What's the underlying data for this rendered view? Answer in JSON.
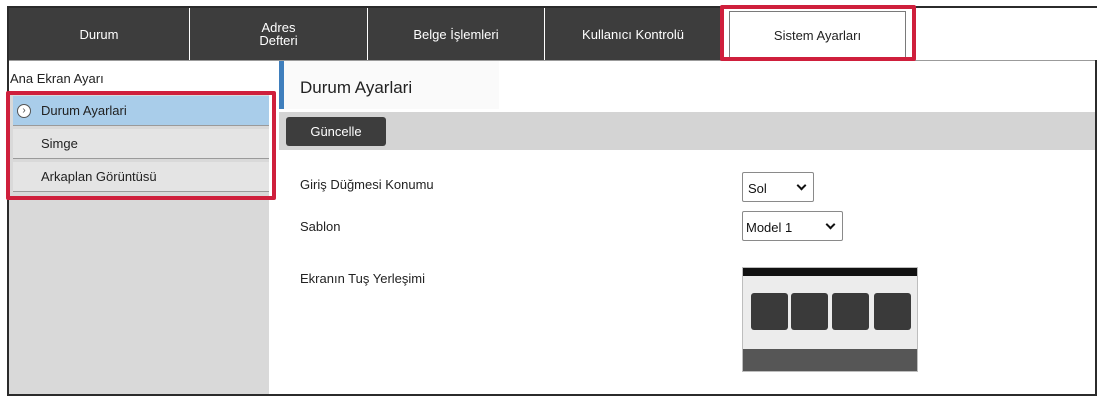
{
  "tabs": [
    {
      "label": "Durum"
    },
    {
      "label_line1": "Adres",
      "label_line2": "Defteri"
    },
    {
      "label": "Belge İşlemleri"
    },
    {
      "label": "Kullanıcı Kontrolü"
    },
    {
      "label": "Sistem Ayarları",
      "active": true
    }
  ],
  "sidebar": {
    "heading": "Ana Ekran Ayarı",
    "items": [
      {
        "label": "Durum Ayarlari",
        "selected": true,
        "icon": "chevron-right-circle-icon"
      },
      {
        "label": "Simge"
      },
      {
        "label": "Arkaplan Görüntüsü"
      }
    ]
  },
  "main": {
    "title": "Durum Ayarlari",
    "update_button": "Güncelle",
    "fields": [
      {
        "label": "Giriş Düğmesi Konumu",
        "value": "Sol"
      },
      {
        "label": "Sablon",
        "value": "Model 1"
      },
      {
        "label": "Ekranın Tuş Yerleşimi"
      }
    ]
  },
  "colors": {
    "tab_bg": "#3d3d3d",
    "highlight": "#cf1f3c",
    "sidebar_selected": "#a9cdea",
    "title_accent": "#3f7fbd"
  }
}
